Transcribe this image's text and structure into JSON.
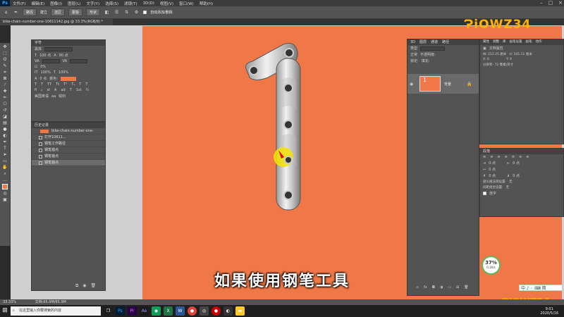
{
  "menu": {
    "items": [
      "文件(F)",
      "编辑(E)",
      "图像(I)",
      "图层(L)",
      "文字(Y)",
      "选择(S)",
      "滤镜(T)",
      "3D(D)",
      "视图(V)",
      "窗口(W)",
      "帮助(H)"
    ]
  },
  "options": {
    "shape_label": "路径",
    "make_label": "建立",
    "selection_btn": "选区",
    "mask_btn": "蒙版",
    "shape_btn": "形状",
    "auto_add_label": "自动添加/删除"
  },
  "document": {
    "tab_title": "bike-chain-number-one-10611142.jpg @ 33.3%(RGB/8) *"
  },
  "character": {
    "tab": "字符",
    "font": "黑体",
    "size": "100 点",
    "leading": "90 点",
    "tracking": "0%",
    "vscale": "100%",
    "hscale": "100%",
    "baseline": "0 点",
    "color_label": "颜色:",
    "lang": "美国英语",
    "aa": "锐利"
  },
  "history": {
    "tab": "历史记录",
    "snapshot": "bike-chain-number-one-10611...",
    "items": [
      "打开",
      "钢笔工作路径",
      "钢笔锚点",
      "钢笔锚点",
      "钢笔锚点"
    ]
  },
  "layers": {
    "tabs": [
      "3D",
      "图层",
      "通道",
      "路径"
    ],
    "kind": "类型",
    "blend": "正常",
    "opacity_label": "不透明度:",
    "fill_label": "填充:",
    "lock_label": "锁定:",
    "layer_name": "背景"
  },
  "properties": {
    "tabs": [
      "属性",
      "调整",
      "库",
      "画笔设置",
      "画笔",
      "动作"
    ],
    "doc_props": "文档属性",
    "w": "W: 212.25 厘米",
    "h": "H: 141.11 厘米",
    "x": "X: 0",
    "y": "Y: 0",
    "res": "分辨率: 72 像素/英寸"
  },
  "paragraph": {
    "tab": "段落",
    "val": "0 点",
    "hyphen_label": "避头尾法则设置:",
    "hyphen_val": "无",
    "spacing_label": "间距组合设置:",
    "spacing_val": "无",
    "hyphenate": "连字"
  },
  "subtitle": "如果使用钢笔工具",
  "logo": "ɁiOWZ34",
  "gauge": {
    "percent": "37%",
    "speed": "0.1K/s"
  },
  "status": "33.33%",
  "doc_size": "文档:65.9M/65.9M",
  "taskbar": {
    "search_placeholder": "在这里输入你要搜索的内容",
    "time": "9:01",
    "date": "2020/5/16"
  },
  "ime": "中 ♪ ◦ ⌨ 简"
}
